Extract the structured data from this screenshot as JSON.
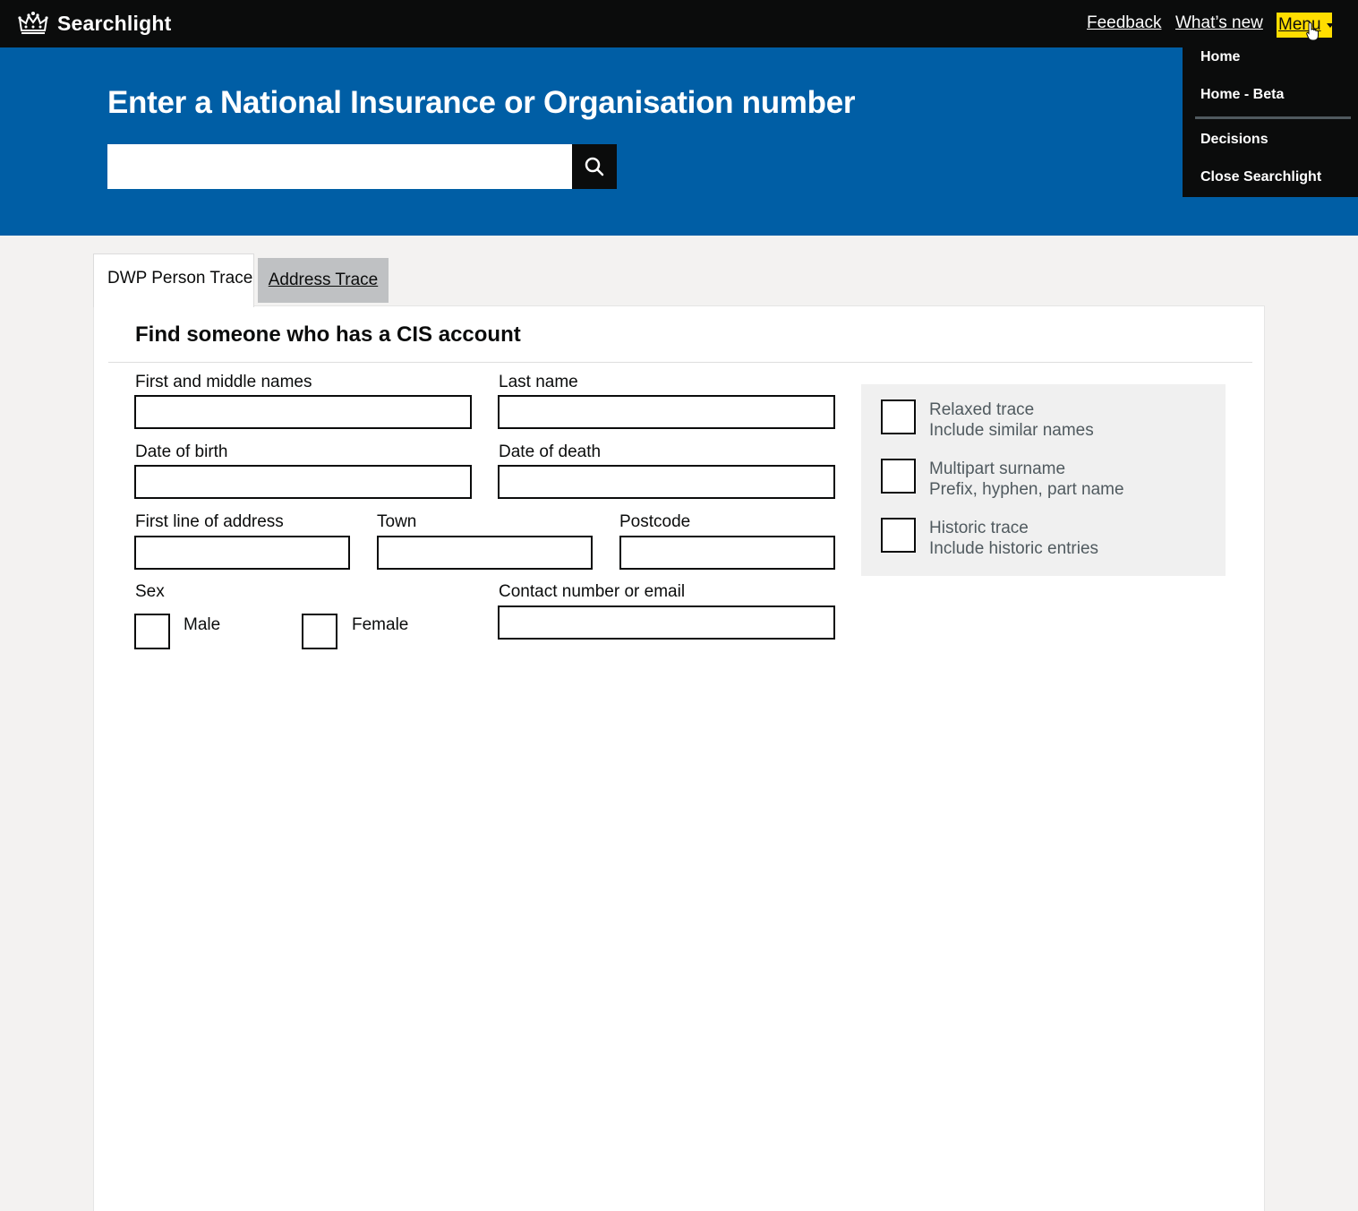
{
  "header": {
    "brand": "Searchlight",
    "nav": {
      "feedback": "Feedback",
      "whats_new": "What’s new",
      "menu": "Menu"
    },
    "menu_items": [
      "Home",
      "Home - Beta",
      "Decisions",
      "Close Searchlight"
    ]
  },
  "hero": {
    "title": "Enter a National Insurance or Organisation number",
    "search_value": ""
  },
  "tabs": [
    {
      "label": "DWP Person Trace",
      "selected": true
    },
    {
      "label": "Address Trace",
      "selected": false
    }
  ],
  "form": {
    "title": "Find someone who has a CIS account",
    "first_names_label": "First and middle names",
    "last_name_label": "Last name",
    "dob_label": "Date of birth",
    "dod_label": "Date of death",
    "address_label": "First line of address",
    "town_label": "Town",
    "postcode_label": "Postcode",
    "sex_label": "Sex",
    "male_label": "Male",
    "female_label": "Female",
    "contact_label": "Contact number or email"
  },
  "options": [
    {
      "title": "Relaxed trace",
      "hint": "Include similar names",
      "checked": false
    },
    {
      "title": "Multipart surname",
      "hint": "Prefix, hyphen, part name",
      "checked": false
    },
    {
      "title": "Historic trace",
      "hint": "Include historic entries",
      "checked": false
    }
  ],
  "colors": {
    "header_bg": "#0b0c0c",
    "hero_bg": "#005ea5",
    "menu_highlight": "#ffdd00",
    "page_bg": "#f3f2f1"
  },
  "icons": {
    "brand": "crown-icon",
    "search": "search-icon",
    "menu_caret": "chevron-down-icon"
  }
}
